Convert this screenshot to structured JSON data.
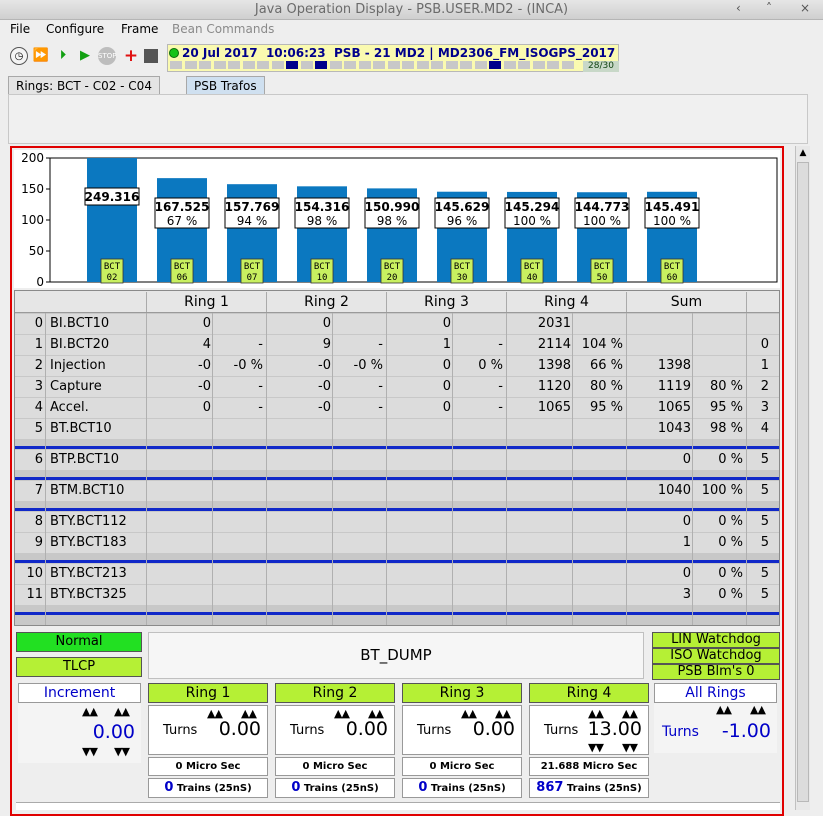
{
  "window": {
    "title": "Java Operation Display  - PSB.USER.MD2 - (INCA)",
    "controls": [
      "‹",
      "˄",
      "×"
    ]
  },
  "menu": [
    "File",
    "Configure",
    "Frame",
    "Bean Commands"
  ],
  "toolbar": {
    "status_date": "20 Jul 2017",
    "status_time": "10:06:23",
    "status_machine": "PSB - 21 MD2",
    "status_cycle": "MD2306_FM_ISOGPS_2017",
    "counter": "28/30"
  },
  "tabs": [
    "Rings:  BCT - C02 - C04",
    "PSB Trafos"
  ],
  "chart_data": {
    "type": "bar",
    "ylim": [
      0,
      200
    ],
    "yticks": [
      0,
      50,
      100,
      150,
      200
    ],
    "categories": [
      "BCT\n02",
      "BCT\n06",
      "BCT\n07",
      "BCT\n10",
      "BCT\n20",
      "BCT\n30",
      "BCT\n40",
      "BCT\n50",
      "BCT\n60"
    ],
    "values": [
      249.316,
      167.525,
      157.769,
      154.316,
      150.99,
      145.629,
      145.294,
      144.773,
      145.491
    ],
    "labels": [
      "249.316",
      "167.525",
      "157.769",
      "154.316",
      "150.990",
      "145.629",
      "145.294",
      "144.773",
      "145.491"
    ],
    "percents": [
      "",
      "67 %",
      "94 %",
      "98 %",
      "98 %",
      "96 %",
      "100 %",
      "100 %",
      "100 %"
    ],
    "bar_color": "#0b78c0"
  },
  "table": {
    "headers": [
      "Ring 1",
      "Ring 2",
      "Ring 3",
      "Ring 4",
      "Sum"
    ],
    "rows": [
      {
        "idx": "0",
        "name": "BI.BCT10",
        "r1": "0",
        "r1p": "",
        "r2": "0",
        "r2p": "",
        "r3": "0",
        "r3p": "",
        "r4": "2031",
        "r4p": "",
        "s": "",
        "sp": "",
        "e": ""
      },
      {
        "idx": "1",
        "name": "BI.BCT20",
        "r1": "4",
        "r1p": "-",
        "r2": "9",
        "r2p": "-",
        "r3": "1",
        "r3p": "-",
        "r4": "2114",
        "r4p": "104 %",
        "s": "",
        "sp": "",
        "e": "0"
      },
      {
        "idx": "2",
        "name": "Injection",
        "r1": "-0",
        "r1p": "-0 %",
        "r2": "-0",
        "r2p": "-0 %",
        "r3": "0",
        "r3p": "0 %",
        "r4": "1398",
        "r4p": "66 %",
        "s": "1398",
        "sp": "",
        "e": "1"
      },
      {
        "idx": "3",
        "name": "Capture",
        "r1": "-0",
        "r1p": "-",
        "r2": "-0",
        "r2p": "-",
        "r3": "0",
        "r3p": "-",
        "r4": "1120",
        "r4p": "80 %",
        "s": "1119",
        "sp": "80 %",
        "e": "2"
      },
      {
        "idx": "4",
        "name": "Accel.",
        "r1": "0",
        "r1p": "-",
        "r2": "-0",
        "r2p": "-",
        "r3": "0",
        "r3p": "-",
        "r4": "1065",
        "r4p": "95 %",
        "s": "1065",
        "sp": "95 %",
        "e": "3"
      },
      {
        "idx": "5",
        "name": "BT.BCT10",
        "r1": "",
        "r1p": "",
        "r2": "",
        "r2p": "",
        "r3": "",
        "r3p": "",
        "r4": "",
        "r4p": "",
        "s": "1043",
        "sp": "98 %",
        "e": "4"
      },
      {
        "idx": "6",
        "name": "BTP.BCT10",
        "r1": "",
        "r1p": "",
        "r2": "",
        "r2p": "",
        "r3": "",
        "r3p": "",
        "r4": "",
        "r4p": "",
        "s": "0",
        "sp": "0 %",
        "e": "5"
      },
      {
        "idx": "7",
        "name": "BTM.BCT10",
        "r1": "",
        "r1p": "",
        "r2": "",
        "r2p": "",
        "r3": "",
        "r3p": "",
        "r4": "",
        "r4p": "",
        "s": "1040",
        "sp": "100 %",
        "e": "5"
      },
      {
        "idx": "8",
        "name": "BTY.BCT112",
        "r1": "",
        "r1p": "",
        "r2": "",
        "r2p": "",
        "r3": "",
        "r3p": "",
        "r4": "",
        "r4p": "",
        "s": "0",
        "sp": "0 %",
        "e": "5"
      },
      {
        "idx": "9",
        "name": "BTY.BCT183",
        "r1": "",
        "r1p": "",
        "r2": "",
        "r2p": "",
        "r3": "",
        "r3p": "",
        "r4": "",
        "r4p": "",
        "s": "1",
        "sp": "0 %",
        "e": "5"
      },
      {
        "idx": "10",
        "name": "BTY.BCT213",
        "r1": "",
        "r1p": "",
        "r2": "",
        "r2p": "",
        "r3": "",
        "r3p": "",
        "r4": "",
        "r4p": "",
        "s": "0",
        "sp": "0 %",
        "e": "5"
      },
      {
        "idx": "11",
        "name": "BTY.BCT325",
        "r1": "",
        "r1p": "",
        "r2": "",
        "r2p": "",
        "r3": "",
        "r3p": "",
        "r4": "",
        "r4p": "",
        "s": "3",
        "sp": "0 %",
        "e": "5"
      }
    ]
  },
  "status": {
    "mode": "Normal",
    "user": "TLCP",
    "destination": "BT_DUMP",
    "watchdogs": [
      "LIN Watchdog",
      "ISO Watchdog",
      "PSB Blm's 0"
    ]
  },
  "increment": {
    "label": "Increment",
    "value": "0.00"
  },
  "rings": [
    {
      "name": "Ring 1",
      "turns_label": "Turns",
      "turns": "0.00",
      "micro": "0 Micro Sec",
      "trains": "0",
      "trains_unit": "Trains (25nS)"
    },
    {
      "name": "Ring 2",
      "turns_label": "Turns",
      "turns": "0.00",
      "micro": "0 Micro Sec",
      "trains": "0",
      "trains_unit": "Trains (25nS)"
    },
    {
      "name": "Ring 3",
      "turns_label": "Turns",
      "turns": "0.00",
      "micro": "0 Micro Sec",
      "trains": "0",
      "trains_unit": "Trains (25nS)"
    },
    {
      "name": "Ring 4",
      "turns_label": "Turns",
      "turns": "13.00",
      "micro": "21.688 Micro Sec",
      "trains": "867",
      "trains_unit": "Trains (25nS)"
    }
  ],
  "all_rings": {
    "label": "All Rings",
    "turns_label": "Turns",
    "turns": "-1.00"
  },
  "colors": {
    "lamp_green": "#22e022",
    "lamp_yellowgreen": "#b5f035",
    "frame_red": "#e00000",
    "value_blue": "#0000c8"
  }
}
